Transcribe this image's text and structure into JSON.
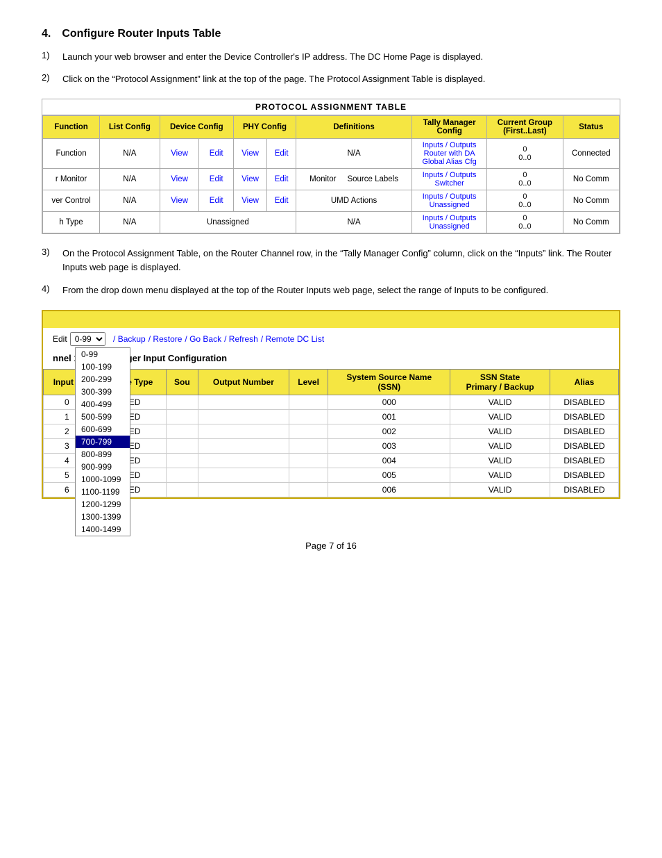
{
  "section": {
    "number": "4.",
    "title": "Configure Router Inputs Table"
  },
  "steps": [
    {
      "num": "1)",
      "text": "Launch your web browser and enter the Device Controller's IP address. The DC Home Page is displayed."
    },
    {
      "num": "2)",
      "text": "Click on the “Protocol Assignment” link at the top of the page.  The Protocol Assignment Table is displayed."
    },
    {
      "num": "3)",
      "text": "On the Protocol Assignment Table, on the Router Channel row, in the “Tally Manager Config” column, click on the “Inputs” link. The Router Inputs web page is displayed."
    },
    {
      "num": "4)",
      "text": "From the drop down menu displayed at the top of the Router Inputs web page, select the range of Inputs to be configured."
    }
  ],
  "proto_table": {
    "title": "PROTOCOL ASSIGNMENT TABLE",
    "headers": [
      "Function",
      "List Config",
      "Device Config",
      "PHY Config",
      "Definitions",
      "Tally Manager Config",
      "Current Group (First..Last)",
      "Status"
    ],
    "rows": [
      {
        "function": "Function",
        "list_config": "N/A",
        "device_config_view": "View",
        "device_config_edit": "Edit",
        "phy_view": "View",
        "phy_edit": "Edit",
        "definitions": "N/A",
        "tally": "Inputs / Outputs\nRouter with DA\nGlobal Alias Cfg",
        "group": "0\n0..0",
        "status": "Connected"
      },
      {
        "function": "r Monitor",
        "list_config": "N/A",
        "device_config_view": "View",
        "device_config_edit": "Edit",
        "phy_view": "View",
        "phy_edit": "Edit",
        "definitions": "Monitor     Source Labels",
        "tally": "Inputs / Outputs\nSwitcher",
        "group": "0\n0..0",
        "status": "No Comm"
      },
      {
        "function": "ver Control",
        "list_config": "N/A",
        "device_config_view": "View",
        "device_config_edit": "Edit",
        "phy_view": "View",
        "phy_edit": "Edit",
        "definitions": "UMD Actions",
        "tally": "Inputs / Outputs\nUnassigned",
        "group": "0\n0..0",
        "status": "No Comm"
      },
      {
        "function": "h Type",
        "list_config": "N/A",
        "device_config_view": "",
        "device_config_edit": "",
        "phy_view": "",
        "phy_edit": "",
        "definitions_prefix": "Unassigned",
        "definitions": "N/A",
        "tally": "Inputs / Outputs\nUnassigned",
        "group": "0\n0..0",
        "status": "No Comm"
      }
    ]
  },
  "router_section": {
    "edit_label": "Edit",
    "dropdown_selected": "0-99",
    "dropdown_options": [
      "0-99",
      "100-199",
      "200-299",
      "300-399",
      "400-499",
      "500-599",
      "600-699",
      "700-799",
      "800-899",
      "900-999",
      "1000-1099",
      "1100-1199",
      "1200-1299",
      "1300-1399",
      "1400-1499"
    ],
    "selected_option": "700-799",
    "links": [
      "/ Backup",
      "/ Restore",
      "/ Go Back",
      "/ Refresh",
      "/ Remote DC List"
    ],
    "subtitle": "nnel 1 Tally Manager Input Configuration",
    "table_headers": [
      "Input #",
      "Source Type",
      "Sou",
      "Output Number",
      "Level",
      "System Source Name (SSN)",
      "SSN State Primary / Backup",
      "Alias"
    ],
    "rows": [
      {
        "input": "0",
        "source_type": "FIXED",
        "sou": "",
        "output": "",
        "level": "",
        "ssn": "000",
        "ssn_state": "VALID",
        "alias": "DISABLED"
      },
      {
        "input": "1",
        "source_type": "FIXED",
        "sou": "",
        "output": "",
        "level": "",
        "ssn": "001",
        "ssn_state": "VALID",
        "alias": "DISABLED"
      },
      {
        "input": "2",
        "source_type": "FIXED",
        "sou": "",
        "output": "",
        "level": "",
        "ssn": "002",
        "ssn_state": "VALID",
        "alias": "DISABLED"
      },
      {
        "input": "3",
        "source_type": "FIXED",
        "sou": "",
        "output": "",
        "level": "",
        "ssn": "003",
        "ssn_state": "VALID",
        "alias": "DISABLED"
      },
      {
        "input": "4",
        "source_type": "FIXED",
        "sou": "",
        "output": "",
        "level": "",
        "ssn": "004",
        "ssn_state": "VALID",
        "alias": "DISABLED"
      },
      {
        "input": "5",
        "source_type": "FIXED",
        "sou": "",
        "output": "",
        "level": "",
        "ssn": "005",
        "ssn_state": "VALID",
        "alias": "DISABLED"
      },
      {
        "input": "6",
        "source_type": "FIXED",
        "sou": "",
        "output": "",
        "level": "",
        "ssn": "006",
        "ssn_state": "VALID",
        "alias": "DISABLED"
      }
    ]
  },
  "footer": {
    "text": "Page 7 of 16"
  }
}
